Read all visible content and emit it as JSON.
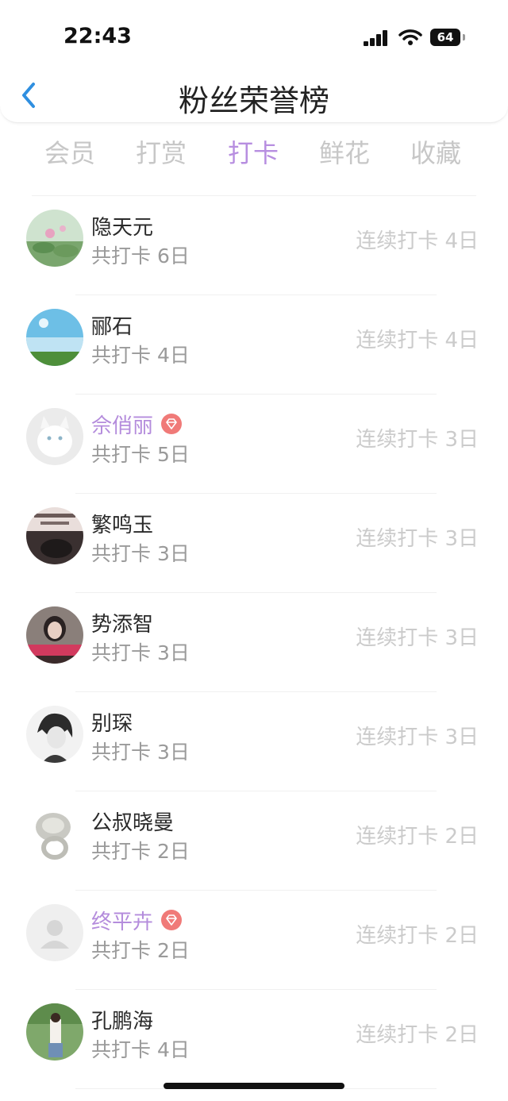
{
  "status_bar": {
    "time": "22:43",
    "battery": "64"
  },
  "header": {
    "title": "粉丝荣誉榜"
  },
  "tabs": [
    {
      "label": "会员",
      "active": false
    },
    {
      "label": "打赏",
      "active": false
    },
    {
      "label": "打卡",
      "active": true
    },
    {
      "label": "鲜花",
      "active": false
    },
    {
      "label": "收藏",
      "active": false
    }
  ],
  "rows": [
    {
      "name": "隐天元",
      "vip": false,
      "total": "共打卡 6日",
      "streak": "连续打卡 4日",
      "avatar": "lotus-avatar"
    },
    {
      "name": "郦石",
      "vip": false,
      "total": "共打卡 4日",
      "streak": "连续打卡 4日",
      "avatar": "sky-avatar"
    },
    {
      "name": "佘俏丽",
      "vip": true,
      "total": "共打卡 5日",
      "streak": "连续打卡 3日",
      "avatar": "cat-avatar"
    },
    {
      "name": "繁鸣玉",
      "vip": false,
      "total": "共打卡 3日",
      "streak": "连续打卡 3日",
      "avatar": "text-avatar"
    },
    {
      "name": "势添智",
      "vip": false,
      "total": "共打卡 3日",
      "streak": "连续打卡 3日",
      "avatar": "girl-avatar"
    },
    {
      "name": "别琛",
      "vip": false,
      "total": "共打卡 3日",
      "streak": "连续打卡 3日",
      "avatar": "sketch-avatar"
    },
    {
      "name": "公叔晓曼",
      "vip": false,
      "total": "共打卡 2日",
      "streak": "连续打卡 2日",
      "avatar": "ring-avatar"
    },
    {
      "name": "终平卉",
      "vip": true,
      "total": "共打卡 2日",
      "streak": "连续打卡 2日",
      "avatar": "default-avatar"
    },
    {
      "name": "孔鹏海",
      "vip": false,
      "total": "共打卡 4日",
      "streak": "连续打卡 2日",
      "avatar": "outdoor-avatar"
    }
  ],
  "colors": {
    "accent": "#b78ee0",
    "vip_name": "#b48cdc",
    "vip_badge": "#f07a78"
  }
}
